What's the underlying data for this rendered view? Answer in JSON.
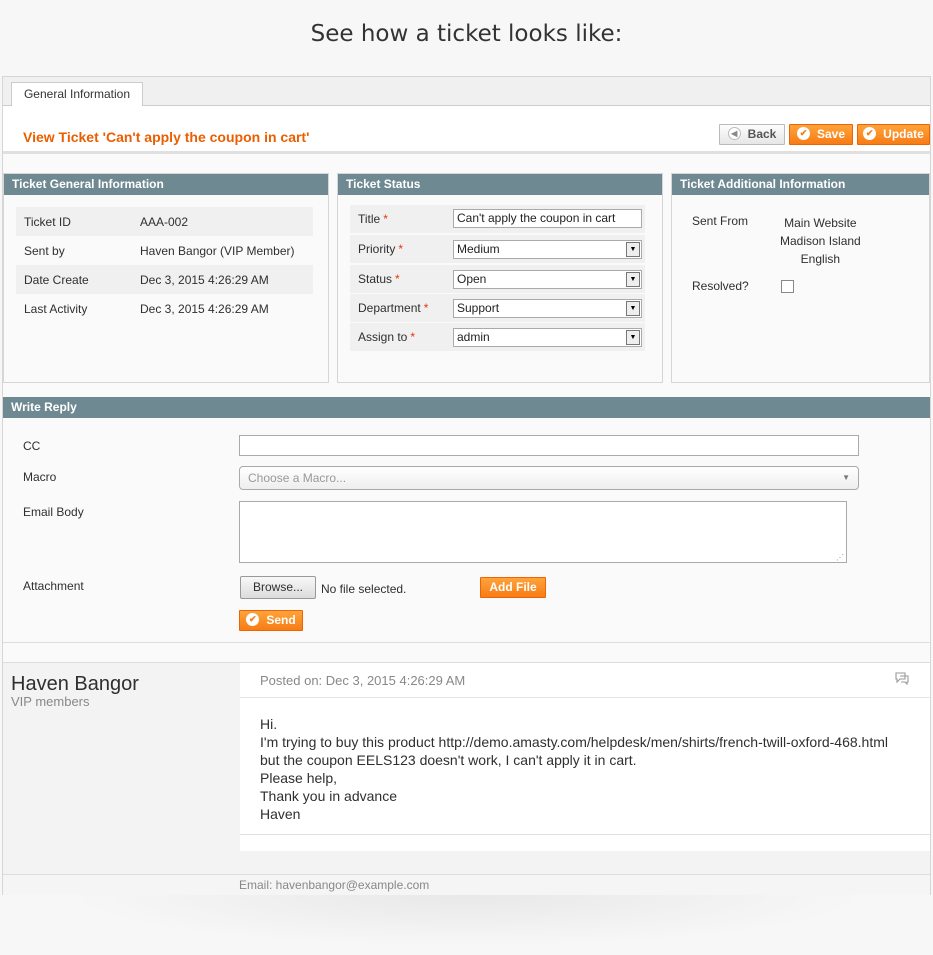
{
  "heading": "See how a ticket looks like:",
  "tabs": {
    "general": "General Information"
  },
  "page_title": "View Ticket 'Can't apply the coupon in cart'",
  "actions": {
    "back": "Back",
    "save": "Save",
    "update": "Update"
  },
  "general_info": {
    "title": "Ticket General Information",
    "rows": [
      {
        "label": "Ticket ID",
        "value": "AAA-002"
      },
      {
        "label": "Sent by",
        "value": "Haven Bangor (VIP Member)"
      },
      {
        "label": "Date Create",
        "value": "Dec 3, 2015 4:26:29 AM"
      },
      {
        "label": "Last Activity",
        "value": "Dec 3, 2015 4:26:29 AM"
      }
    ]
  },
  "status": {
    "title": "Ticket Status",
    "title_label": "Title",
    "title_value": "Can't apply the coupon in cart",
    "priority_label": "Priority",
    "priority_value": "Medium",
    "status_label": "Status",
    "status_value": "Open",
    "department_label": "Department",
    "department_value": "Support",
    "assign_label": "Assign to",
    "assign_value": "admin",
    "required_mark": "*"
  },
  "additional": {
    "title": "Ticket Additional Information",
    "sent_from_label": "Sent From",
    "sent_from_lines": [
      "Main Website",
      "Madison Island",
      "English"
    ],
    "resolved_label": "Resolved?"
  },
  "reply": {
    "title": "Write Reply",
    "cc_label": "CC",
    "cc_value": "",
    "macro_label": "Macro",
    "macro_placeholder": "Choose a Macro...",
    "body_label": "Email Body",
    "attachment_label": "Attachment",
    "browse_label": "Browse...",
    "file_status": "No file selected.",
    "add_file_label": "Add File",
    "send_label": "Send"
  },
  "post": {
    "author": "Haven Bangor",
    "author_group": "VIP members",
    "posted_on": "Posted on: Dec 3, 2015 4:26:29 AM",
    "body_lines": [
      "Hi.",
      "I'm trying to buy this product http://demo.amasty.com/helpdesk/men/shirts/french-twill-oxford-468.html",
      "but the coupon EELS123 doesn't work, I can't apply it in cart.",
      "Please help,",
      "Thank you in advance",
      "Haven"
    ],
    "email_line": "Email: havenbangor@example.com"
  }
}
